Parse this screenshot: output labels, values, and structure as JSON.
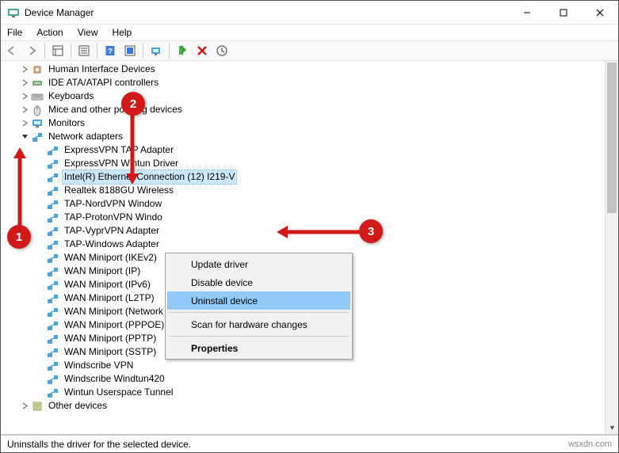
{
  "window": {
    "title": "Device Manager"
  },
  "menu": {
    "file": "File",
    "action": "Action",
    "view": "View",
    "help": "Help"
  },
  "tree": {
    "categories": [
      {
        "label": "Human Interface Devices",
        "iconKey": "hid",
        "expanded": false
      },
      {
        "label": "IDE ATA/ATAPI controllers",
        "iconKey": "ide",
        "expanded": false
      },
      {
        "label": "Keyboards",
        "iconKey": "kbd",
        "expanded": false
      },
      {
        "label": "Mice and other pointing devices",
        "iconKey": "mouse",
        "expanded": false
      },
      {
        "label": "Monitors",
        "iconKey": "monitor",
        "expanded": false
      },
      {
        "label": "Network adapters",
        "iconKey": "net",
        "expanded": true,
        "children": [
          {
            "label": "ExpressVPN TAP Adapter"
          },
          {
            "label": "ExpressVPN Wintun Driver"
          },
          {
            "label": "Intel(R) Ethernet Connection (12) I219-V",
            "selected": true
          },
          {
            "label": "Realtek 8188GU Wireless"
          },
          {
            "label": "TAP-NordVPN Window"
          },
          {
            "label": "TAP-ProtonVPN Windo"
          },
          {
            "label": "TAP-VyprVPN Adapter"
          },
          {
            "label": "TAP-Windows Adapter"
          },
          {
            "label": "WAN Miniport (IKEv2)"
          },
          {
            "label": "WAN Miniport (IP)"
          },
          {
            "label": "WAN Miniport (IPv6)"
          },
          {
            "label": "WAN Miniport (L2TP)"
          },
          {
            "label": "WAN Miniport (Network Monitor)"
          },
          {
            "label": "WAN Miniport (PPPOE)"
          },
          {
            "label": "WAN Miniport (PPTP)"
          },
          {
            "label": "WAN Miniport (SSTP)"
          },
          {
            "label": "Windscribe VPN"
          },
          {
            "label": "Windscribe Windtun420"
          },
          {
            "label": "Wintun Userspace Tunnel"
          }
        ]
      },
      {
        "label": "Other devices",
        "iconKey": "other",
        "expanded": false
      }
    ]
  },
  "contextMenu": {
    "items": [
      {
        "label": "Update driver",
        "type": "item"
      },
      {
        "label": "Disable device",
        "type": "item"
      },
      {
        "label": "Uninstall device",
        "type": "item",
        "highlight": true
      },
      {
        "type": "sep"
      },
      {
        "label": "Scan for hardware changes",
        "type": "item"
      },
      {
        "type": "sep"
      },
      {
        "label": "Properties",
        "type": "item",
        "bold": true
      }
    ]
  },
  "status": {
    "text": "Uninstalls the driver for the selected device."
  },
  "watermark": "wsxdn.com",
  "callouts": {
    "c1": "1",
    "c2": "2",
    "c3": "3"
  }
}
